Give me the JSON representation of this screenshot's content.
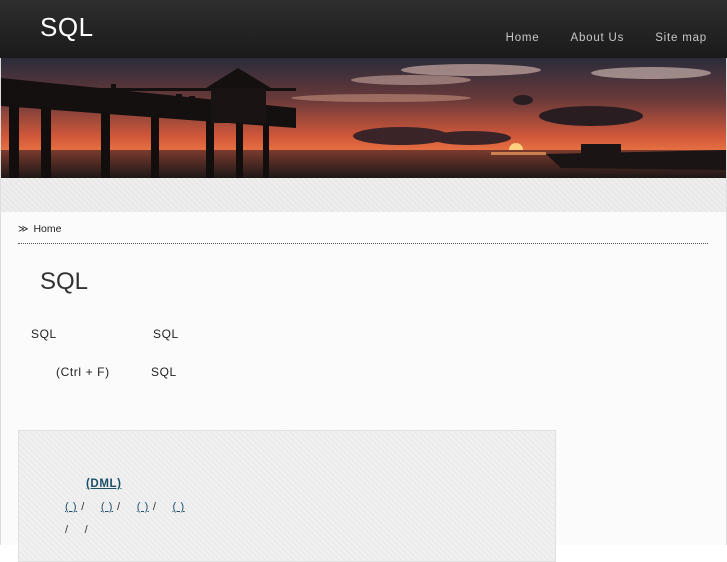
{
  "header": {
    "site_title": "SQL",
    "nav": [
      "Home",
      "About Us",
      "Site map"
    ]
  },
  "breadcrumb": {
    "arrow": "≫",
    "home": "Home"
  },
  "main": {
    "title": "SQL",
    "line1_left": "SQL",
    "line1_right": "SQL",
    "line2_left": "(Ctrl + F)",
    "line2_right": "SQL"
  },
  "menu": {
    "heading": "(DML)",
    "row1": [
      "( )",
      "( )",
      "( )",
      "( )"
    ],
    "row2": [
      "",
      "",
      ""
    ]
  },
  "colors": {
    "header_bg": "#1f1f1f",
    "link": "#1d4f6b",
    "nav_text": "#c8c8c8"
  }
}
